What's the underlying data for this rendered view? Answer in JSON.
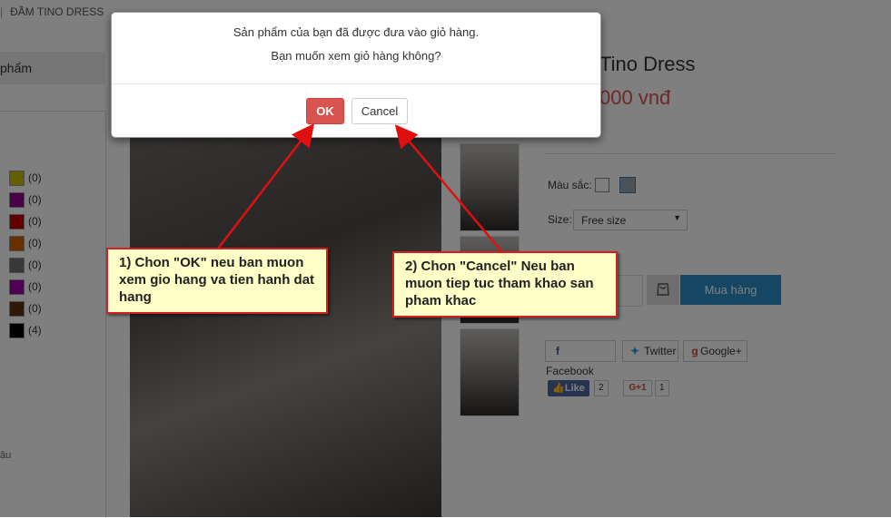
{
  "breadcrumb": {
    "separator": "|",
    "current": "ĐẦM TINO DRESS"
  },
  "category_bar": {
    "label": "phẩm"
  },
  "color_filter": [
    {
      "color": "#c8c000",
      "count": "(0)"
    },
    {
      "color": "#900090",
      "count": "(0)"
    },
    {
      "color": "#c00000",
      "count": "(0)"
    },
    {
      "color": "#d06000",
      "count": "(0)"
    },
    {
      "color": "#707070",
      "count": "(0)"
    },
    {
      "color": "#a000a8",
      "count": "(0)"
    },
    {
      "color": "#603010",
      "count": "(0)"
    },
    {
      "color": "#000000",
      "count": "(4)"
    }
  ],
  "partial_text": "âu",
  "product": {
    "title": "Tino Dress",
    "price": "000 vnđ",
    "color_label": "Màu sắc:",
    "size_label": "Size:",
    "size_value": "Free size",
    "buy_label": "Mua hàng",
    "share": {
      "facebook": "Facebook",
      "twitter": "Twitter",
      "google": "Google+"
    },
    "like_label": "Like",
    "like_count": "2",
    "gplus_label": "G+1",
    "gplus_count": "1"
  },
  "modal": {
    "line1": "Sản phẩm của bạn đã được đưa vào giỏ hàng.",
    "line2": "Bạn muốn xem giỏ hàng không?",
    "ok_label": "OK",
    "cancel_label": "Cancel"
  },
  "annotations": {
    "callout1": "1) Chon \"OK\" neu ban muon xem gio hang va tien hanh dat hang",
    "callout2": "2) Chon \"Cancel\" Neu ban muon tiep tuc tham khao san pham khac"
  },
  "colors": {
    "ok": "#d9534f",
    "buy": "#2b8ec9",
    "callout_bg": "#ffffc8",
    "callout_border": "#d42020",
    "arrow": "#e01010"
  }
}
